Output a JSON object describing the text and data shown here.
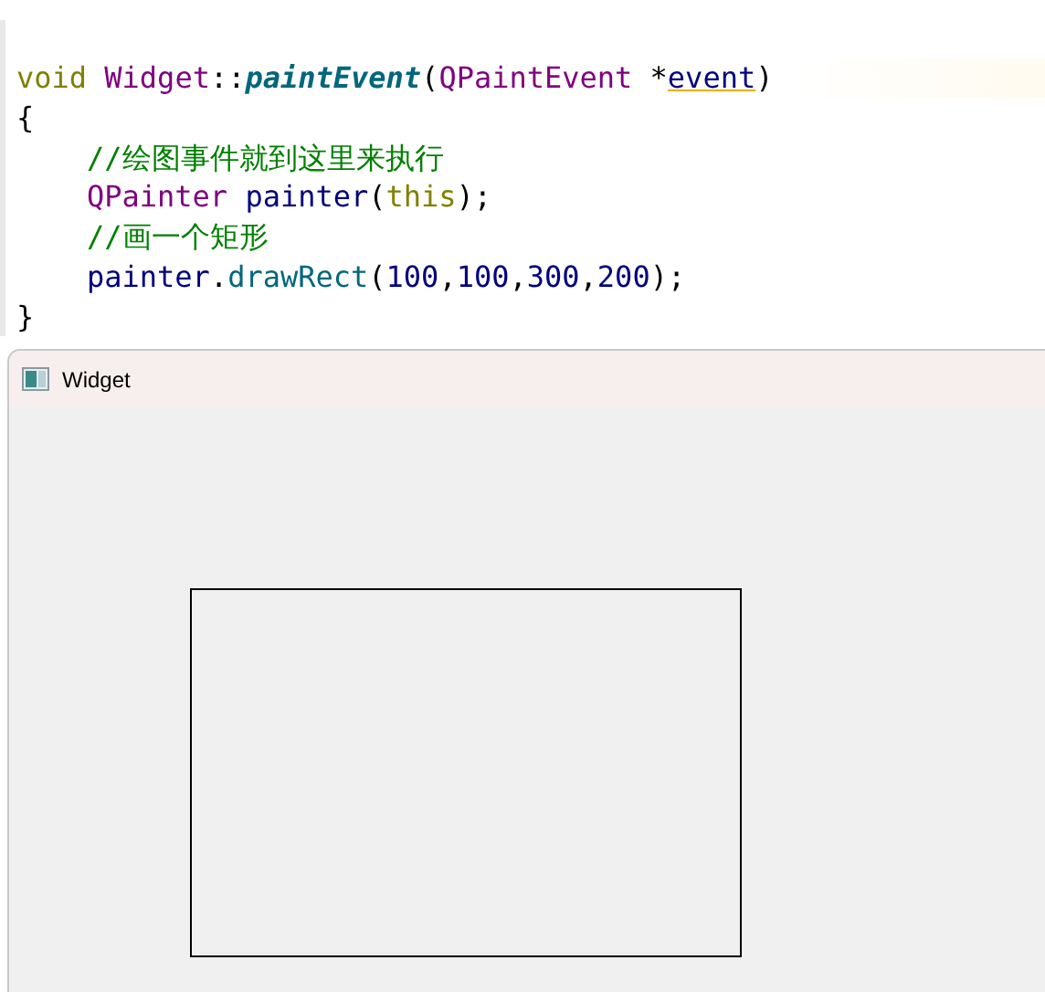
{
  "editor": {
    "lines": [
      {
        "current": false
      },
      {
        "current": true,
        "indent": false,
        "tokens": [
          {
            "text": "void",
            "kind": "keyword"
          },
          {
            "text": "Widget",
            "kind": "type",
            "space_before": true
          },
          {
            "text": "::",
            "kind": "plain"
          },
          {
            "text": "paintEvent",
            "kind": "function"
          },
          {
            "text": "(",
            "kind": "plain"
          },
          {
            "text": "QPaintEvent",
            "kind": "type"
          },
          {
            "text": "*",
            "kind": "plain",
            "space_before": true
          },
          {
            "text": "event",
            "kind": "param"
          },
          {
            "text": ")",
            "kind": "plain"
          }
        ]
      },
      {
        "current": false,
        "indent": false,
        "tokens": [
          {
            "text": "{",
            "kind": "plain"
          }
        ]
      },
      {
        "current": false,
        "indent": true,
        "tokens": [
          {
            "text": "//绘图事件就到这里来执行",
            "kind": "comment"
          }
        ]
      },
      {
        "current": false,
        "indent": true,
        "tokens": [
          {
            "text": "QPainter",
            "kind": "type"
          },
          {
            "text": "painter",
            "kind": "variable",
            "space_before": true
          },
          {
            "text": "(",
            "kind": "plain"
          },
          {
            "text": "this",
            "kind": "keyword"
          },
          {
            "text": ");",
            "kind": "plain"
          }
        ]
      },
      {
        "current": false,
        "indent": true,
        "tokens": [
          {
            "text": "//画一个矩形",
            "kind": "comment"
          }
        ]
      },
      {
        "current": false,
        "indent": true,
        "tokens": [
          {
            "text": "painter",
            "kind": "variable"
          },
          {
            "text": ".",
            "kind": "plain"
          },
          {
            "text": "drawRect",
            "kind": "method"
          },
          {
            "text": "(",
            "kind": "plain"
          },
          {
            "text": "100",
            "kind": "number"
          },
          {
            "text": ",",
            "kind": "plain"
          },
          {
            "text": "100",
            "kind": "number"
          },
          {
            "text": ",",
            "kind": "plain"
          },
          {
            "text": "300",
            "kind": "number"
          },
          {
            "text": ",",
            "kind": "plain"
          },
          {
            "text": "200",
            "kind": "number"
          },
          {
            "text": ");",
            "kind": "plain"
          }
        ]
      },
      {
        "current": false,
        "indent": false,
        "tokens": [
          {
            "text": "}",
            "kind": "plain"
          }
        ]
      }
    ]
  },
  "window": {
    "title": "Widget"
  }
}
